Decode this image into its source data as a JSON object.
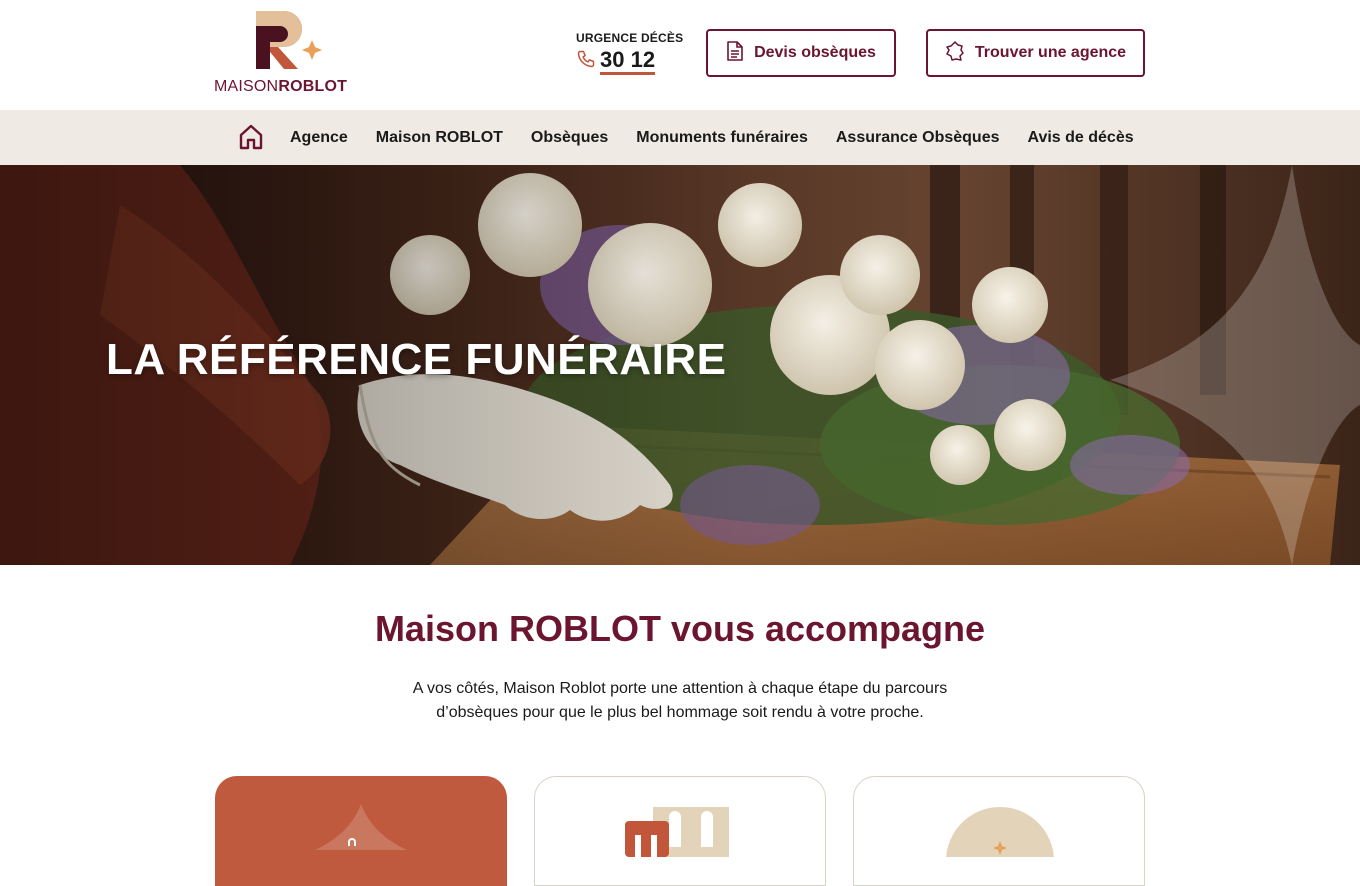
{
  "header": {
    "logo": {
      "text_light": "MAISON",
      "text_bold": "ROBLOT"
    },
    "urgence": {
      "label": "URGENCE DÉCÈS",
      "number": "30 12"
    },
    "devis_button": "Devis obsèques",
    "agence_button": "Trouver une agence"
  },
  "nav": {
    "items": [
      {
        "label": "Agence"
      },
      {
        "label": "Maison ROBLOT"
      },
      {
        "label": "Obsèques"
      },
      {
        "label": "Monuments funéraires"
      },
      {
        "label": "Assurance Obsèques"
      },
      {
        "label": "Avis de décès"
      }
    ]
  },
  "hero": {
    "title": "LA RÉFÉRENCE FUNÉRAIRE"
  },
  "section": {
    "title": "Maison ROBLOT vous accompagne",
    "text": "A vos côtés, Maison Roblot porte une attention à chaque étape du parcours d’obsèques pour que le plus bel hommage soit rendu à votre proche."
  },
  "colors": {
    "brand": "#6b1530",
    "accent": "#c2563b",
    "nav_bg": "#efebe4",
    "card_terracotta": "#bf5a3e",
    "beige": "#e3d3b8"
  },
  "icons": [
    "phone-icon",
    "document-icon",
    "map-france-icon",
    "home-icon"
  ]
}
